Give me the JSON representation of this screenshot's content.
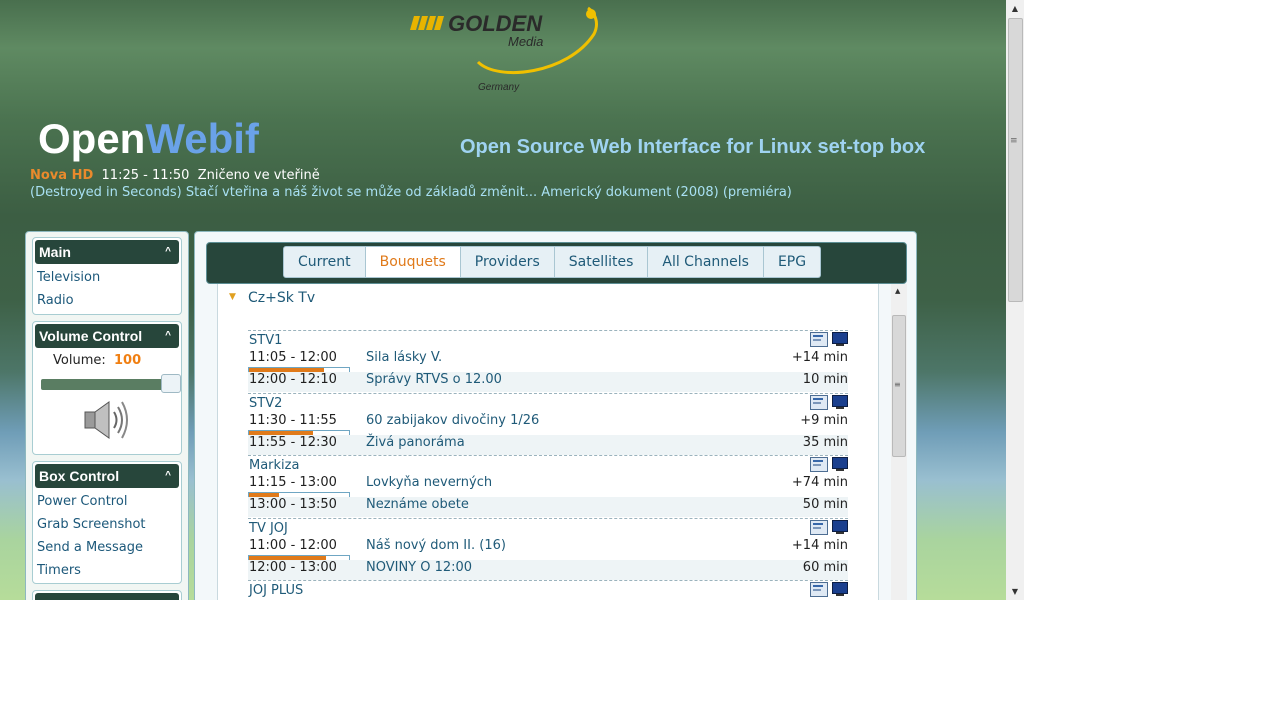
{
  "header": {
    "logo": {
      "brand": "GOLDEN",
      "sub": "Media",
      "country": "Germany"
    },
    "title_open": "Open",
    "title_webif": "Webif",
    "tagline": "Open Source Web Interface for Linux set-top box"
  },
  "now_playing": {
    "channel": "Nova HD",
    "time": "11:25 - 11:50",
    "title": "Zničeno ve vteřině",
    "description": "(Destroyed in Seconds) Stačí vteřina a náš život se může od základů změnit... Americký dokument (2008) (premiéra)"
  },
  "sidebar": {
    "main": {
      "title": "Main",
      "items": [
        {
          "label": "Television"
        },
        {
          "label": "Radio"
        }
      ]
    },
    "volume": {
      "title": "Volume Control",
      "label": "Volume:",
      "value": "100",
      "level": 1.0
    },
    "box_control": {
      "title": "Box Control",
      "items": [
        {
          "label": "Power Control"
        },
        {
          "label": "Grab Screenshot"
        },
        {
          "label": "Send a Message"
        },
        {
          "label": "Timers"
        }
      ]
    }
  },
  "tabs": [
    {
      "label": "Current"
    },
    {
      "label": "Bouquets",
      "active": true
    },
    {
      "label": "Providers"
    },
    {
      "label": "Satellites"
    },
    {
      "label": "All Channels"
    },
    {
      "label": "EPG"
    }
  ],
  "bouquet": {
    "name": "Cz+Sk Tv",
    "channels": [
      {
        "name": "STV1",
        "now": {
          "time": "11:05 - 12:00",
          "title": "Sila lásky V.",
          "remaining": "+14 min",
          "progress": 0.75
        },
        "next": {
          "time": "12:00 - 12:10",
          "title": "Správy RTVS o 12.00",
          "duration": "10 min"
        }
      },
      {
        "name": "STV2",
        "now": {
          "time": "11:30 - 11:55",
          "title": "60 zabijakov divočiny 1/26",
          "remaining": "+9 min",
          "progress": 0.64
        },
        "next": {
          "time": "11:55 - 12:30",
          "title": "Živá panoráma",
          "duration": "35 min"
        }
      },
      {
        "name": "Markiza",
        "now": {
          "time": "11:15 - 13:00",
          "title": "Lovkyňa neverných",
          "remaining": "+74 min",
          "progress": 0.3
        },
        "next": {
          "time": "13:00 - 13:50",
          "title": "Neznáme obete",
          "duration": "50 min"
        }
      },
      {
        "name": "TV JOJ",
        "now": {
          "time": "11:00 - 12:00",
          "title": "Náš nový dom II. (16)",
          "remaining": "+14 min",
          "progress": 0.77
        },
        "next": {
          "time": "12:00 - 13:00",
          "title": "NOVINY O 12:00",
          "duration": "60 min"
        }
      },
      {
        "name": "JOJ PLUS"
      }
    ]
  }
}
